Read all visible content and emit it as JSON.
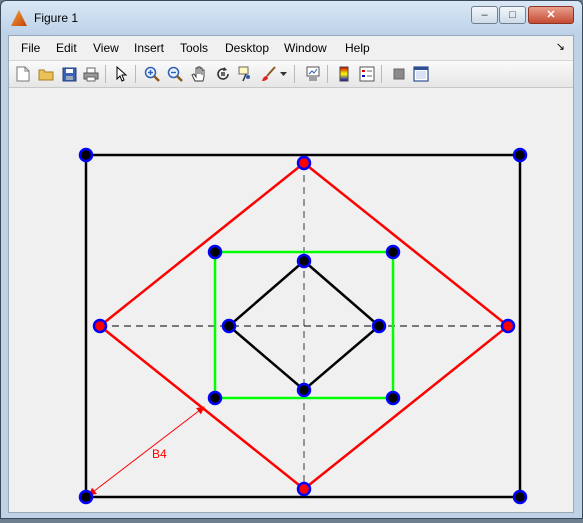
{
  "window": {
    "title": "Figure 1",
    "controls": {
      "minimize": "–",
      "maximize": "□",
      "close": "✕"
    }
  },
  "menubar": {
    "items": [
      "File",
      "Edit",
      "View",
      "Insert",
      "Tools",
      "Desktop",
      "Window",
      "Help"
    ],
    "overflow_icon": "dock-arrow-icon"
  },
  "toolbar": {
    "buttons": [
      "new-figure-icon",
      "open-file-icon",
      "save-icon",
      "print-icon",
      "edit-plot-arrow-icon",
      "zoom-in-icon",
      "zoom-out-icon",
      "pan-hand-icon",
      "rotate-3d-icon",
      "data-cursor-icon",
      "brush-icon",
      "brush-dropdown-icon",
      "link-plot-icon",
      "colorbar-icon",
      "legend-icon",
      "hide-plot-tools-icon",
      "show-plot-tools-icon"
    ]
  },
  "figure": {
    "annotation_label": "B4",
    "colors": {
      "outer_square": "#000000",
      "red_diamond": "#ff0000",
      "green_square": "#00ff00",
      "inner_diamond": "#000000",
      "vertex_blue": "#0000ff",
      "vertex_red": "#ff0000",
      "axis_dash": "#777777"
    }
  }
}
